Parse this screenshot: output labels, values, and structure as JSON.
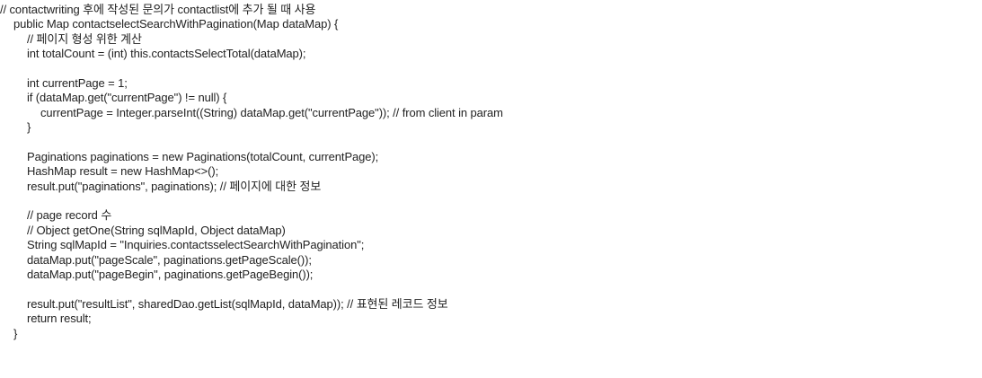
{
  "code": {
    "lines": [
      {
        "indent": 0,
        "text": "// contactwriting 후에 작성된 문의가 contactlist에 추가 될 때 사용"
      },
      {
        "indent": 1,
        "text": "public Map contactselectSearchWithPagination(Map dataMap) {"
      },
      {
        "indent": 2,
        "text": "// 페이지 형성 위한 계산"
      },
      {
        "indent": 2,
        "text": "int totalCount = (int) this.contactsSelectTotal(dataMap);"
      },
      {
        "indent": 0,
        "text": ""
      },
      {
        "indent": 2,
        "text": "int currentPage = 1;"
      },
      {
        "indent": 2,
        "text": "if (dataMap.get(\"currentPage\") != null) {"
      },
      {
        "indent": 3,
        "text": "currentPage = Integer.parseInt((String) dataMap.get(\"currentPage\")); // from client in param"
      },
      {
        "indent": 2,
        "text": "}"
      },
      {
        "indent": 0,
        "text": ""
      },
      {
        "indent": 2,
        "text": "Paginations paginations = new Paginations(totalCount, currentPage);"
      },
      {
        "indent": 2,
        "text": "HashMap result = new HashMap<>();"
      },
      {
        "indent": 2,
        "text": "result.put(\"paginations\", paginations); // 페이지에 대한 정보"
      },
      {
        "indent": 0,
        "text": ""
      },
      {
        "indent": 2,
        "text": "// page record 수"
      },
      {
        "indent": 2,
        "text": "// Object getOne(String sqlMapId, Object dataMap)"
      },
      {
        "indent": 2,
        "text": "String sqlMapId = \"Inquiries.contactsselectSearchWithPagination\";"
      },
      {
        "indent": 2,
        "text": "dataMap.put(\"pageScale\", paginations.getPageScale());"
      },
      {
        "indent": 2,
        "text": "dataMap.put(\"pageBegin\", paginations.getPageBegin());"
      },
      {
        "indent": 0,
        "text": ""
      },
      {
        "indent": 2,
        "text": "result.put(\"resultList\", sharedDao.getList(sqlMapId, dataMap)); // 표현된 레코드 정보"
      },
      {
        "indent": 2,
        "text": "return result;"
      },
      {
        "indent": 1,
        "text": "}"
      }
    ]
  }
}
